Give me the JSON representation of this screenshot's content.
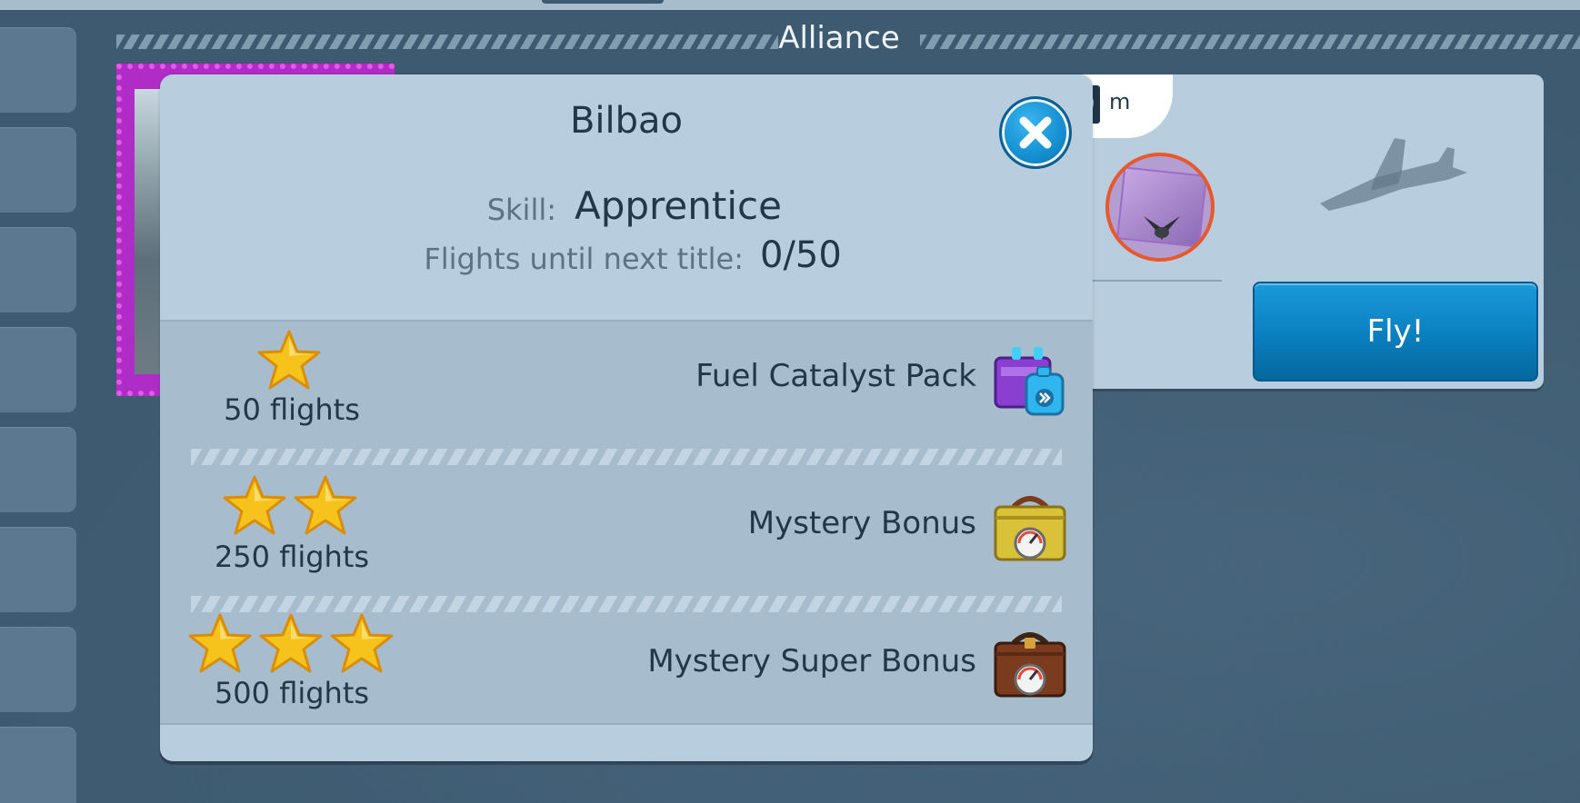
{
  "alliance": {
    "title": "Alliance"
  },
  "timer": {
    "digit": "0",
    "unit": "m"
  },
  "fly_button": {
    "label": "Fly!"
  },
  "modal": {
    "title": "Bilbao",
    "skill_label": "Skill:",
    "skill_value": "Apprentice",
    "flights_label": "Flights until next title:",
    "flights_value": "0/50"
  },
  "rewards": [
    {
      "stars": 1,
      "requirement": "50 flights",
      "name": "Fuel Catalyst Pack",
      "icon": "fuel-catalyst-pack-icon"
    },
    {
      "stars": 2,
      "requirement": "250 flights",
      "name": "Mystery Bonus",
      "icon": "gold-toolbox-icon"
    },
    {
      "stars": 3,
      "requirement": "500 flights",
      "name": "Mystery Super Bonus",
      "icon": "brown-toolbox-icon"
    }
  ],
  "colors": {
    "background": "#3d5a70",
    "panel": "#b8cddd",
    "rewards_panel": "#a7bdcd",
    "accent_blue": "#0a7fbf",
    "badge_border": "#e7582b",
    "stamp_purple": "#b02cc6",
    "star_gold": "#f6c21c"
  }
}
